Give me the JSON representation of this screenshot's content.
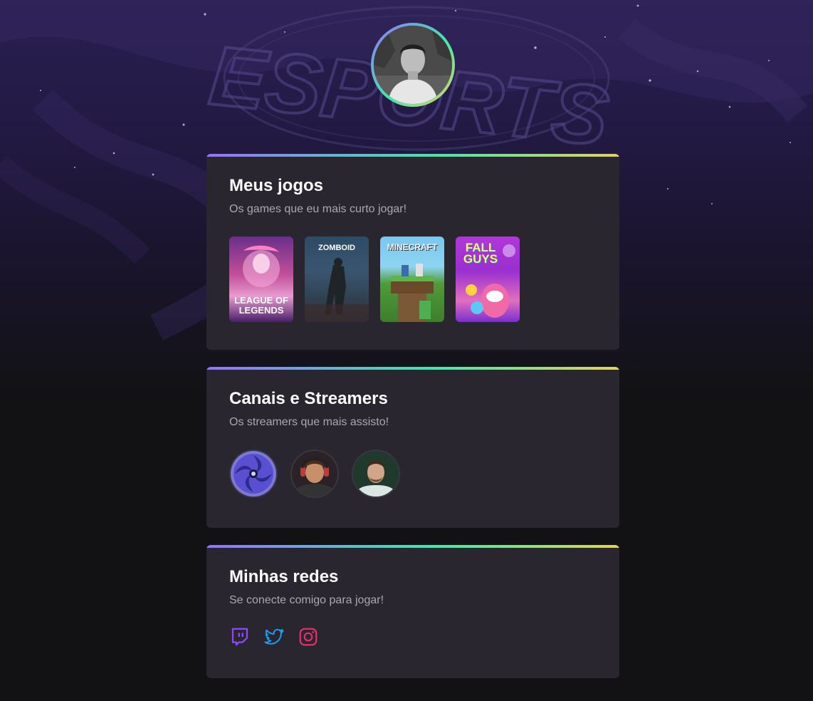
{
  "profile": {
    "avatar_alt": "Foto de perfil"
  },
  "background": {
    "logo_text": "ESPORTS"
  },
  "sections": {
    "games": {
      "title": "Meus jogos",
      "subtitle": "Os games que eu mais curto jogar!",
      "items": [
        {
          "name": "League of Legends",
          "cover_lines": [
            "LEAGUE OF",
            "LEGENDS"
          ]
        },
        {
          "name": "Project Zomboid",
          "cover_lines": [
            "ZOMBOID"
          ]
        },
        {
          "name": "Minecraft",
          "cover_lines": [
            "MINECRAFT"
          ]
        },
        {
          "name": "Fall Guys",
          "cover_lines": [
            "FALL",
            "GUYS"
          ]
        }
      ]
    },
    "streamers": {
      "title": "Canais e Streamers",
      "subtitle": "Os streamers que mais assisto!",
      "items": [
        {
          "name": "streamer-1"
        },
        {
          "name": "streamer-2"
        },
        {
          "name": "streamer-3"
        }
      ]
    },
    "socials": {
      "title": "Minhas redes",
      "subtitle": "Se conecte comigo para jogar!",
      "items": [
        {
          "name": "twitch",
          "icon": "twitch-icon",
          "color": "#9146FF"
        },
        {
          "name": "twitter",
          "icon": "twitter-icon",
          "color": "#1D9BF0"
        },
        {
          "name": "instagram",
          "icon": "instagram-icon",
          "color": "#E1306C"
        }
      ]
    }
  },
  "colors": {
    "gradient_start": "#9572FC",
    "gradient_mid": "#43E7AD",
    "gradient_end": "#E2D45C",
    "card_bg": "#29262f",
    "page_bg": "#121214"
  }
}
